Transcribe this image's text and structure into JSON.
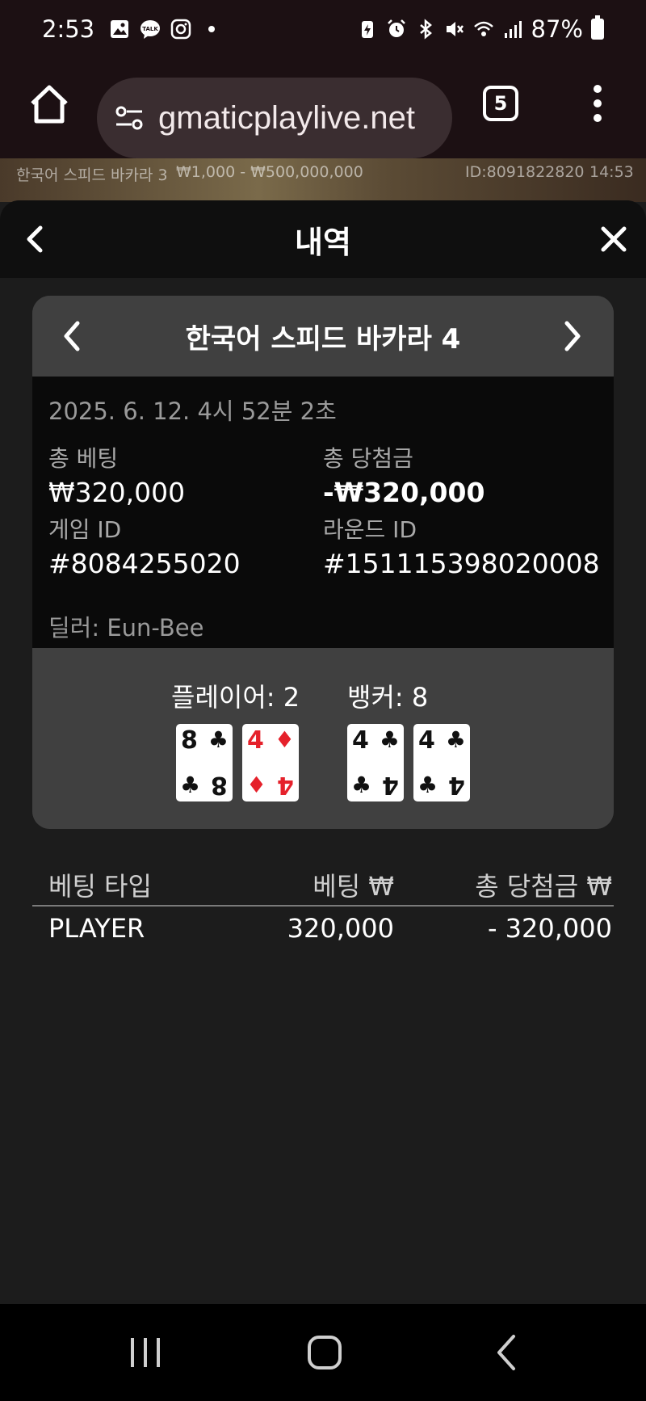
{
  "status_bar": {
    "time": "2:53",
    "battery": "87%"
  },
  "browser": {
    "url": "gmaticplaylive.net",
    "tab_count": "5"
  },
  "game_strip": {
    "table_name": "한국어 스피드 바카라 3",
    "limits": "₩1,000 - ₩500,000,000",
    "id": "ID:8091822820",
    "time": "14:53"
  },
  "panel": {
    "title": "내역"
  },
  "round": {
    "table_title": "한국어 스피드 바카라 4",
    "datetime": "2025. 6. 12. 4시 52분 2초",
    "total_bet_label": "총 베팅",
    "total_bet_value": "₩320,000",
    "total_win_label": "총 당첨금",
    "total_win_value": "-₩320,000",
    "game_id_label": "게임 ID",
    "game_id_value": "#8084255020",
    "round_id_label": "라운드 ID",
    "round_id_value": "#151115398020008",
    "dealer": "딜러: Eun-Bee"
  },
  "result": {
    "player_label": "플레이어: 2",
    "banker_label": "뱅커: 8",
    "player_cards": [
      {
        "rank": "8",
        "suit": "♣",
        "color": "#111111"
      },
      {
        "rank": "4",
        "suit": "♦",
        "color": "#e5212b"
      }
    ],
    "banker_cards": [
      {
        "rank": "4",
        "suit": "♣",
        "color": "#111111"
      },
      {
        "rank": "4",
        "suit": "♣",
        "color": "#111111"
      }
    ]
  },
  "bets": {
    "headers": [
      "베팅 타입",
      "베팅 ₩",
      "총 당첨금 ₩"
    ],
    "rows": [
      {
        "type": "PLAYER",
        "bet": "320,000",
        "win": "- 320,000"
      }
    ]
  }
}
